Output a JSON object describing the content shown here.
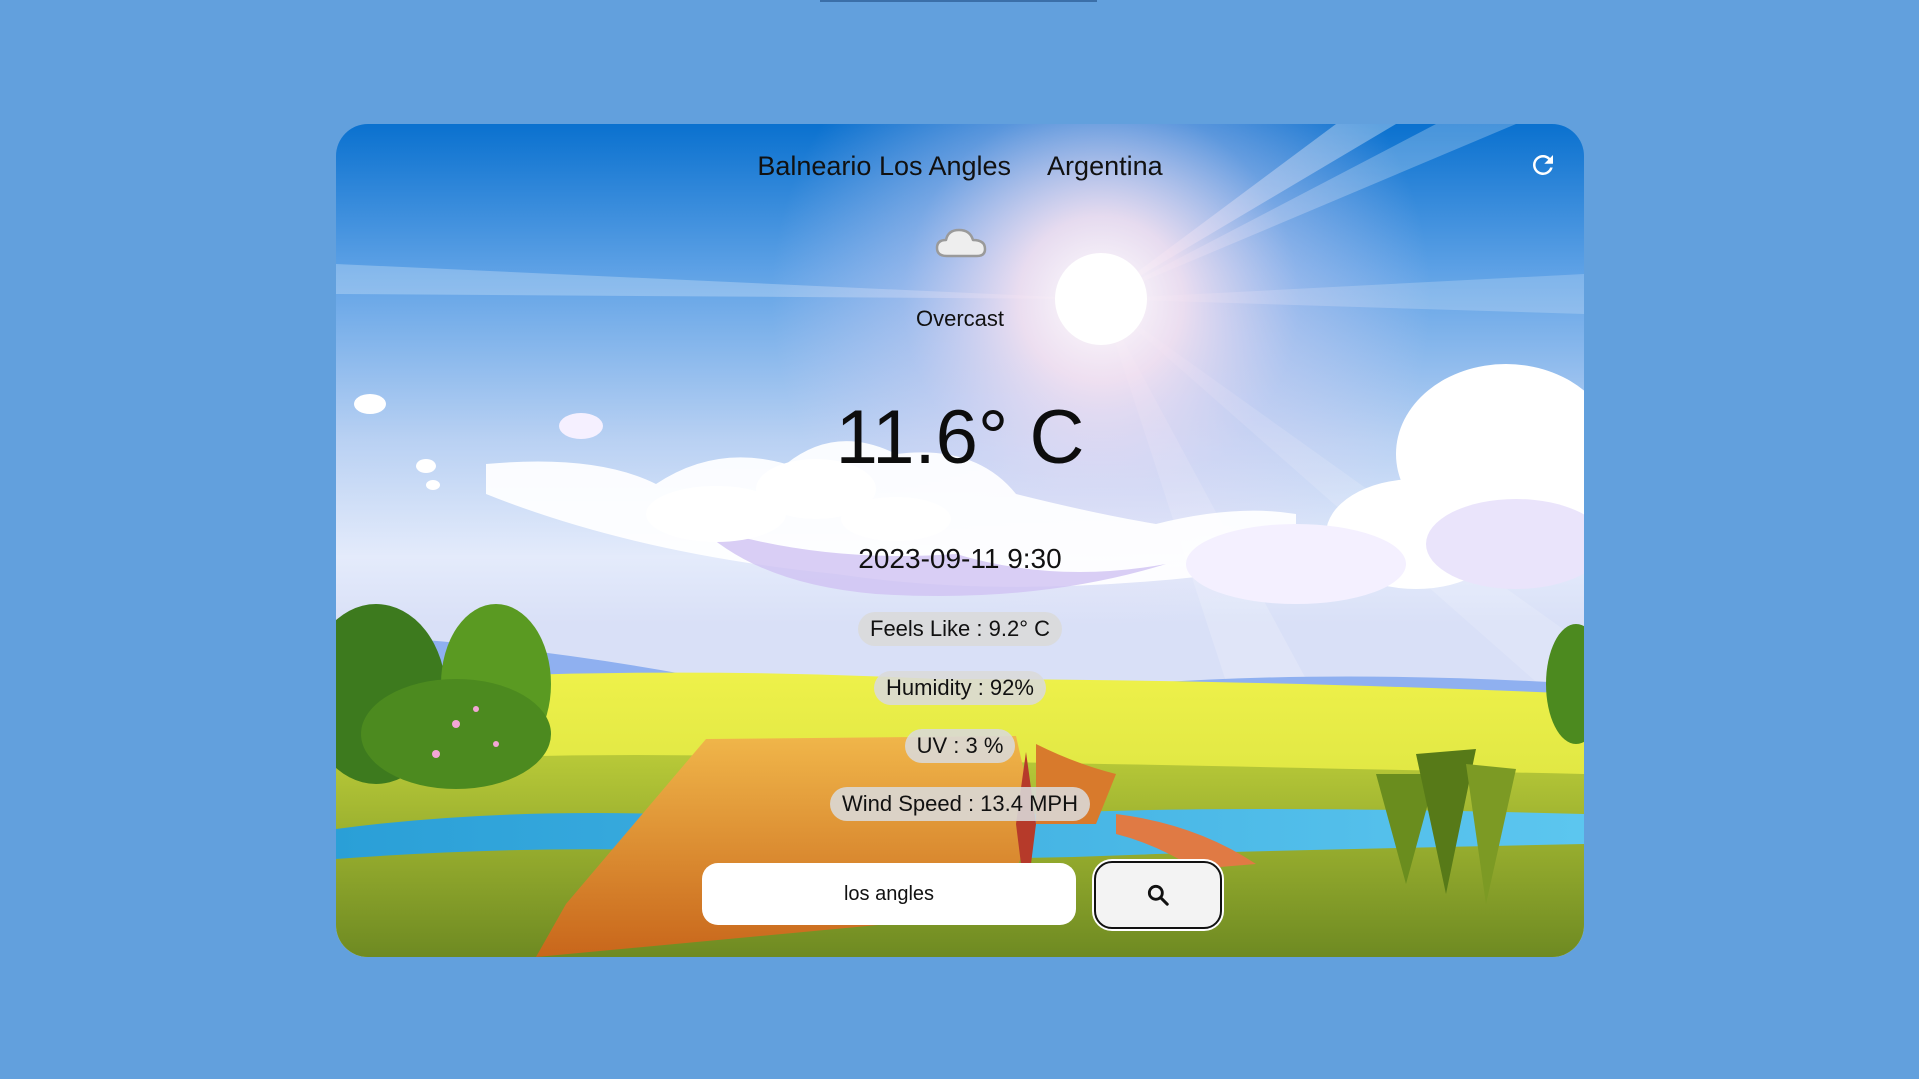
{
  "location": {
    "city": "Balneario Los Angles",
    "country": "Argentina"
  },
  "weather": {
    "condition": "Overcast",
    "condition_icon": "cloud-icon",
    "temperature": "11.6° C",
    "datetime": "2023-09-11 9:30",
    "feels_like": "Feels Like : 9.2° C",
    "humidity": "Humidity : 92%",
    "uv": "UV : 3 %",
    "wind_speed": "Wind Speed : 13.4 MPH"
  },
  "search": {
    "value": "los angles",
    "button_icon": "search-icon"
  },
  "refresh": {
    "icon": "refresh-icon"
  },
  "colors": {
    "page_background": "#62a0dd",
    "pill_background": "#dadada"
  }
}
